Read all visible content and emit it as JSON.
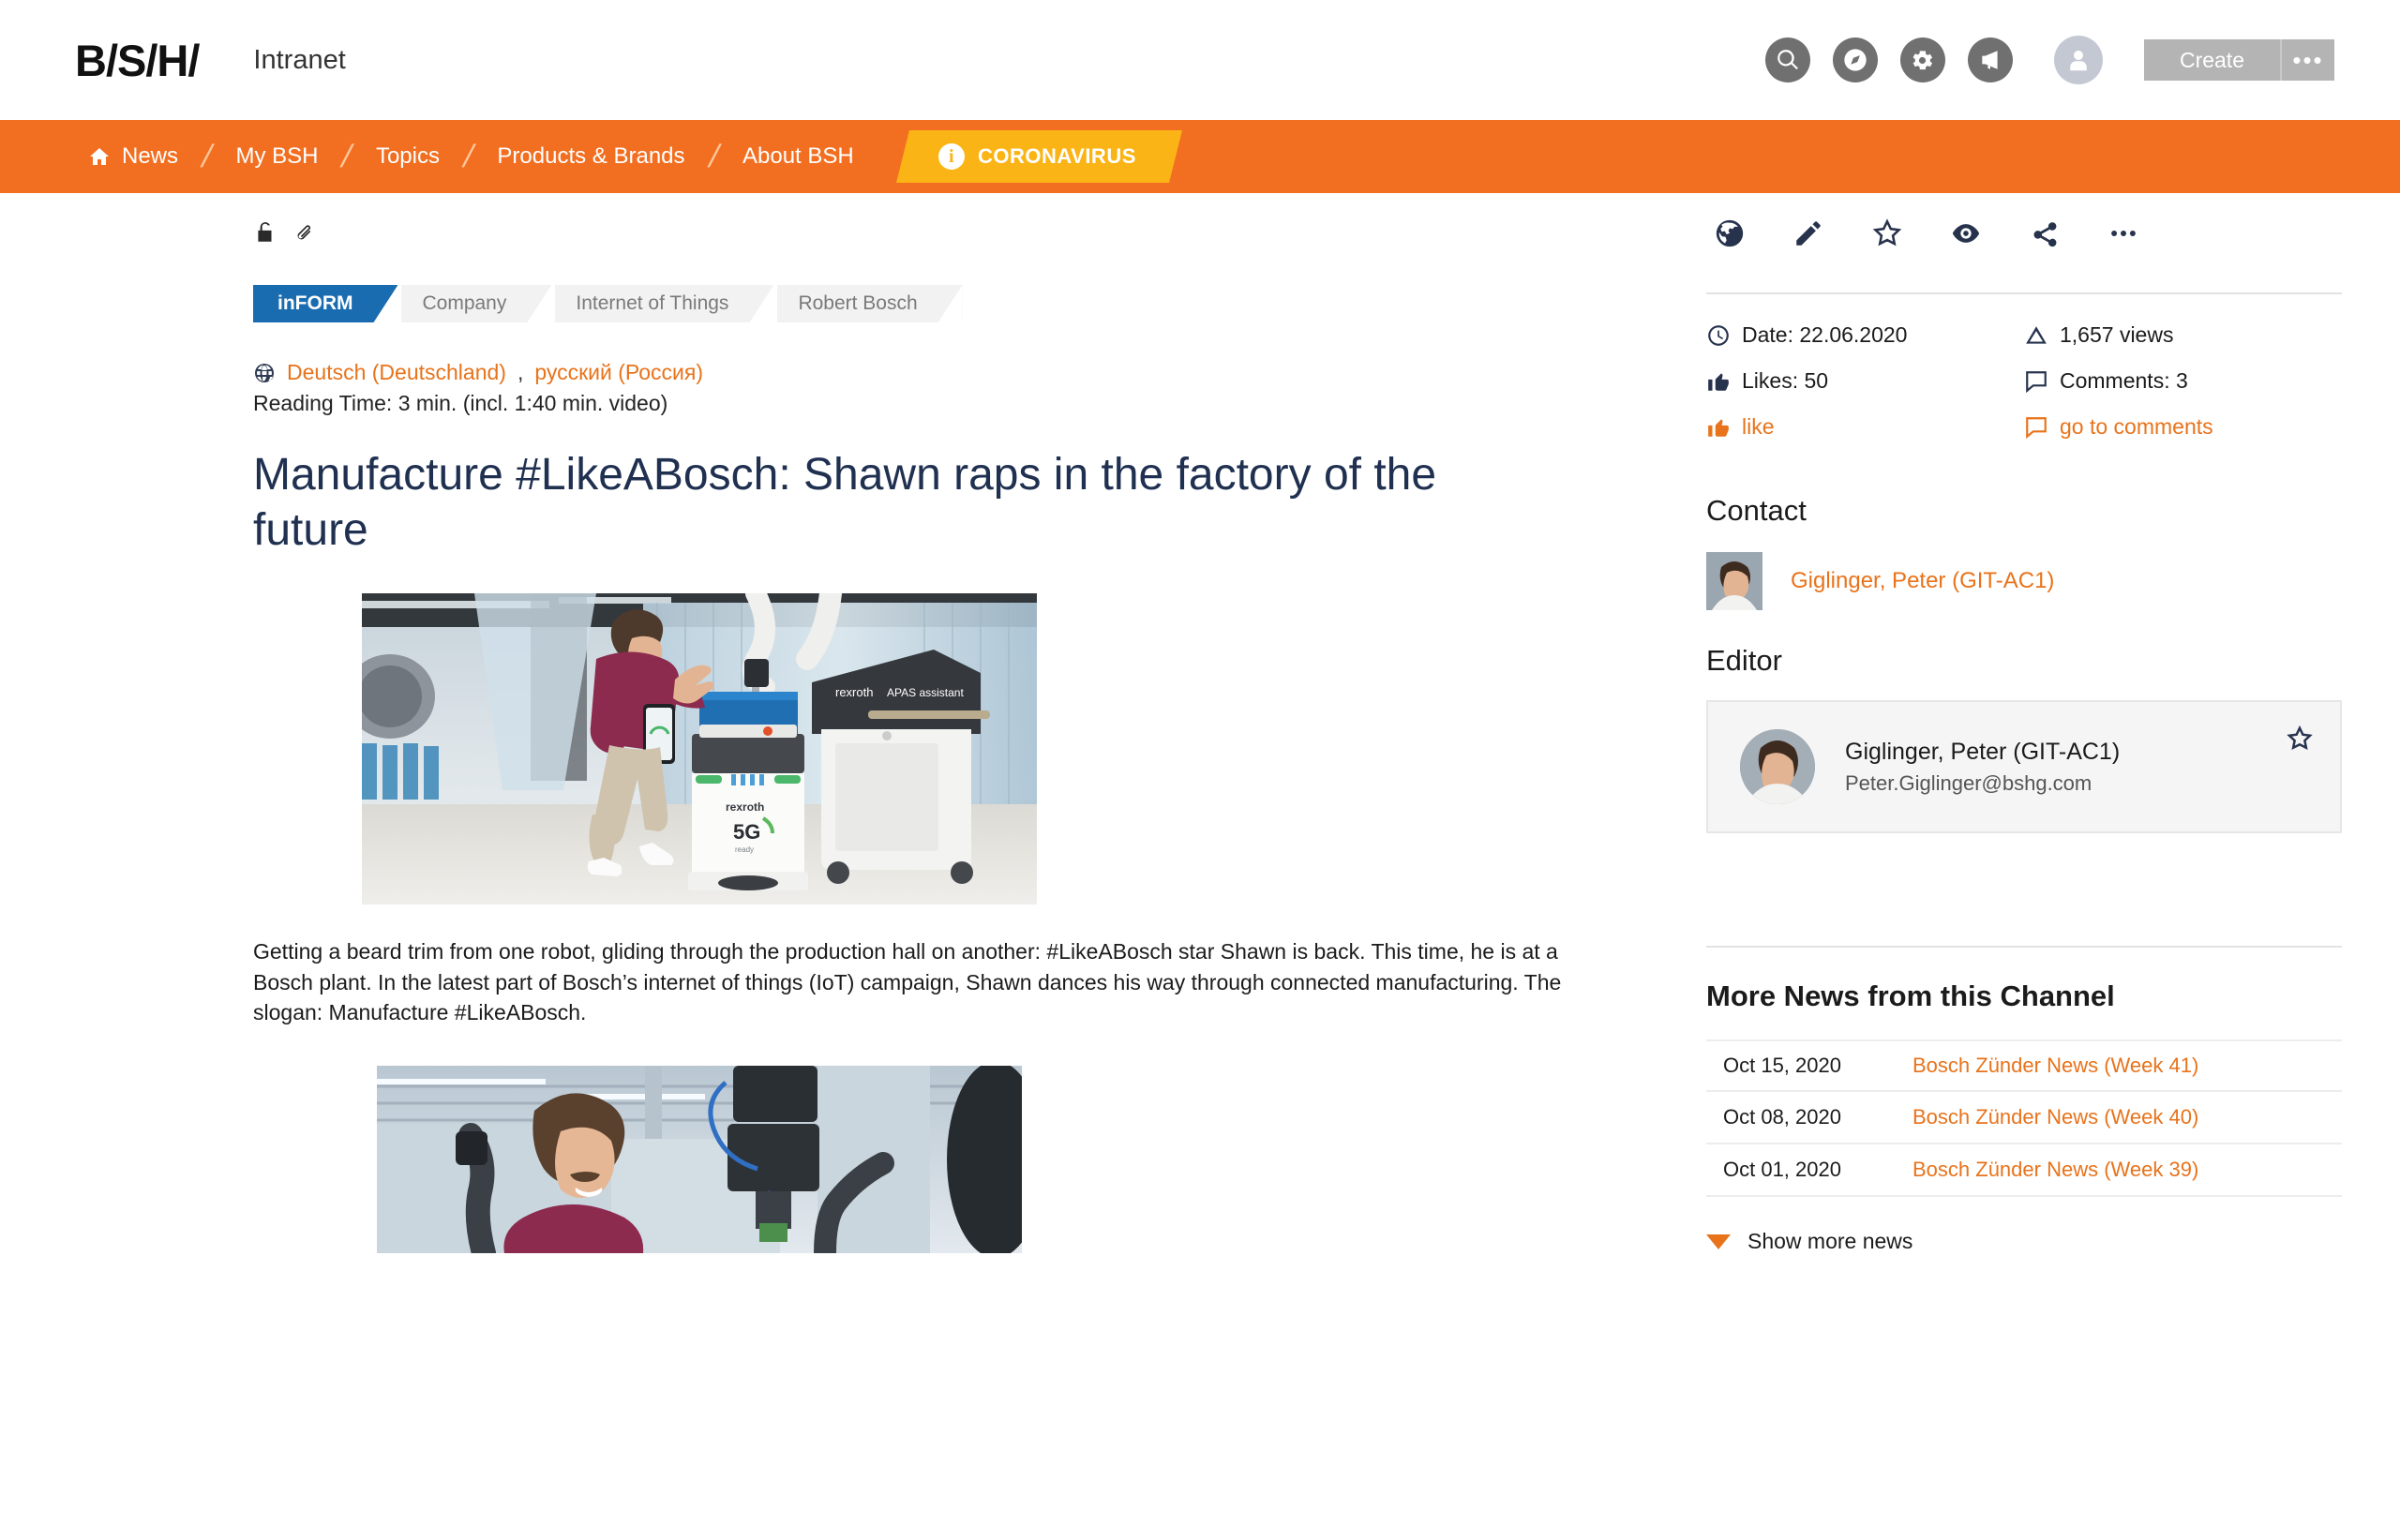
{
  "header": {
    "logo": "B/S/H/",
    "app_title": "Intranet",
    "icons": [
      "search-icon",
      "compass-icon",
      "gear-icon",
      "megaphone-icon"
    ],
    "avatar": "user-avatar",
    "create_label": "Create",
    "more_label": "•••"
  },
  "nav": {
    "items": [
      {
        "label": "News",
        "icon": "home-icon"
      },
      {
        "label": "My BSH",
        "icon": ""
      },
      {
        "label": "Topics",
        "icon": ""
      },
      {
        "label": "Products & Brands",
        "icon": ""
      },
      {
        "label": "About BSH",
        "icon": ""
      }
    ],
    "separator": "/",
    "highlight": {
      "label": "CORONAVIRUS",
      "icon": "info-icon",
      "badge": "i"
    }
  },
  "article": {
    "meta_icons": [
      "unlock-icon",
      "paperclip-icon"
    ],
    "tags": [
      {
        "label": "inFORM",
        "active": true
      },
      {
        "label": "Company",
        "active": false
      },
      {
        "label": "Internet of Things",
        "active": false
      },
      {
        "label": "Robert Bosch",
        "active": false
      }
    ],
    "languages": {
      "icon": "globe-icon",
      "first": "Deutsch (Deutschland)",
      "comma": ",",
      "second": "русский (Россия)"
    },
    "reading_time": "Reading Time: 3 min. (incl. 1:40 min. video)",
    "title": "Manufacture #LikeABosch: Shawn raps in the factory of the future",
    "hero_image_alt": "Man in maroon polo dancing beside rexroth 5G mobile robot and rexroth APAS assistant in a factory hall",
    "hero_labels": {
      "brand": "rexroth",
      "badge": "5G",
      "sub": "ready",
      "assistant": "rexroth APAS assistant"
    },
    "body": "Getting a beard trim from one robot, gliding through the production hall on another: #LikeABosch star Shawn is back. This time, he is at a Bosch plant. In the latest part of Bosch’s internet of things (IoT) campaign, Shawn dances his way through connected manufacturing. The slogan: Manufacture #LikeABosch.",
    "second_image_alt": "Smiling man in maroon polo in front of robot arms in a production hall"
  },
  "sidebar": {
    "action_icons": [
      "globe-icon",
      "pencil-icon",
      "star-icon",
      "eye-icon",
      "share-icon",
      "ellipsis-icon"
    ],
    "stats": [
      {
        "icon": "clock-icon",
        "label": "Date: 22.06.2020",
        "link": false
      },
      {
        "icon": "views-icon",
        "label": "1,657 views",
        "link": false
      },
      {
        "icon": "thumbs-up-icon",
        "label": "Likes: 50",
        "link": false
      },
      {
        "icon": "comment-icon",
        "label": "Comments: 3",
        "link": false
      },
      {
        "icon": "thumbs-up-icon",
        "label": "like",
        "link": true
      },
      {
        "icon": "comment-icon",
        "label": "go to comments",
        "link": true
      }
    ],
    "contact": {
      "heading": "Contact",
      "name": "Giglinger, Peter (GIT-AC1)"
    },
    "editor": {
      "heading": "Editor",
      "name": "Giglinger, Peter (GIT-AC1)",
      "email": "Peter.Giglinger@bshg.com",
      "star_icon": "star-outline-icon"
    },
    "news": {
      "heading": "More News from this Channel",
      "rows": [
        {
          "date": "Oct 15, 2020",
          "title": "Bosch Zünder News (Week 41)"
        },
        {
          "date": "Oct 08, 2020",
          "title": "Bosch Zünder News (Week 40)"
        },
        {
          "date": "Oct 01, 2020",
          "title": "Bosch Zünder News (Week 39)"
        }
      ],
      "show_more": "Show more news"
    }
  },
  "colors": {
    "brand_orange": "#f26f21",
    "link_orange": "#e8731b",
    "accent_blue": "#1a6cb0",
    "highlight_amber": "#fbb416",
    "title_navy": "#203050",
    "icon_navy": "#27334d"
  }
}
